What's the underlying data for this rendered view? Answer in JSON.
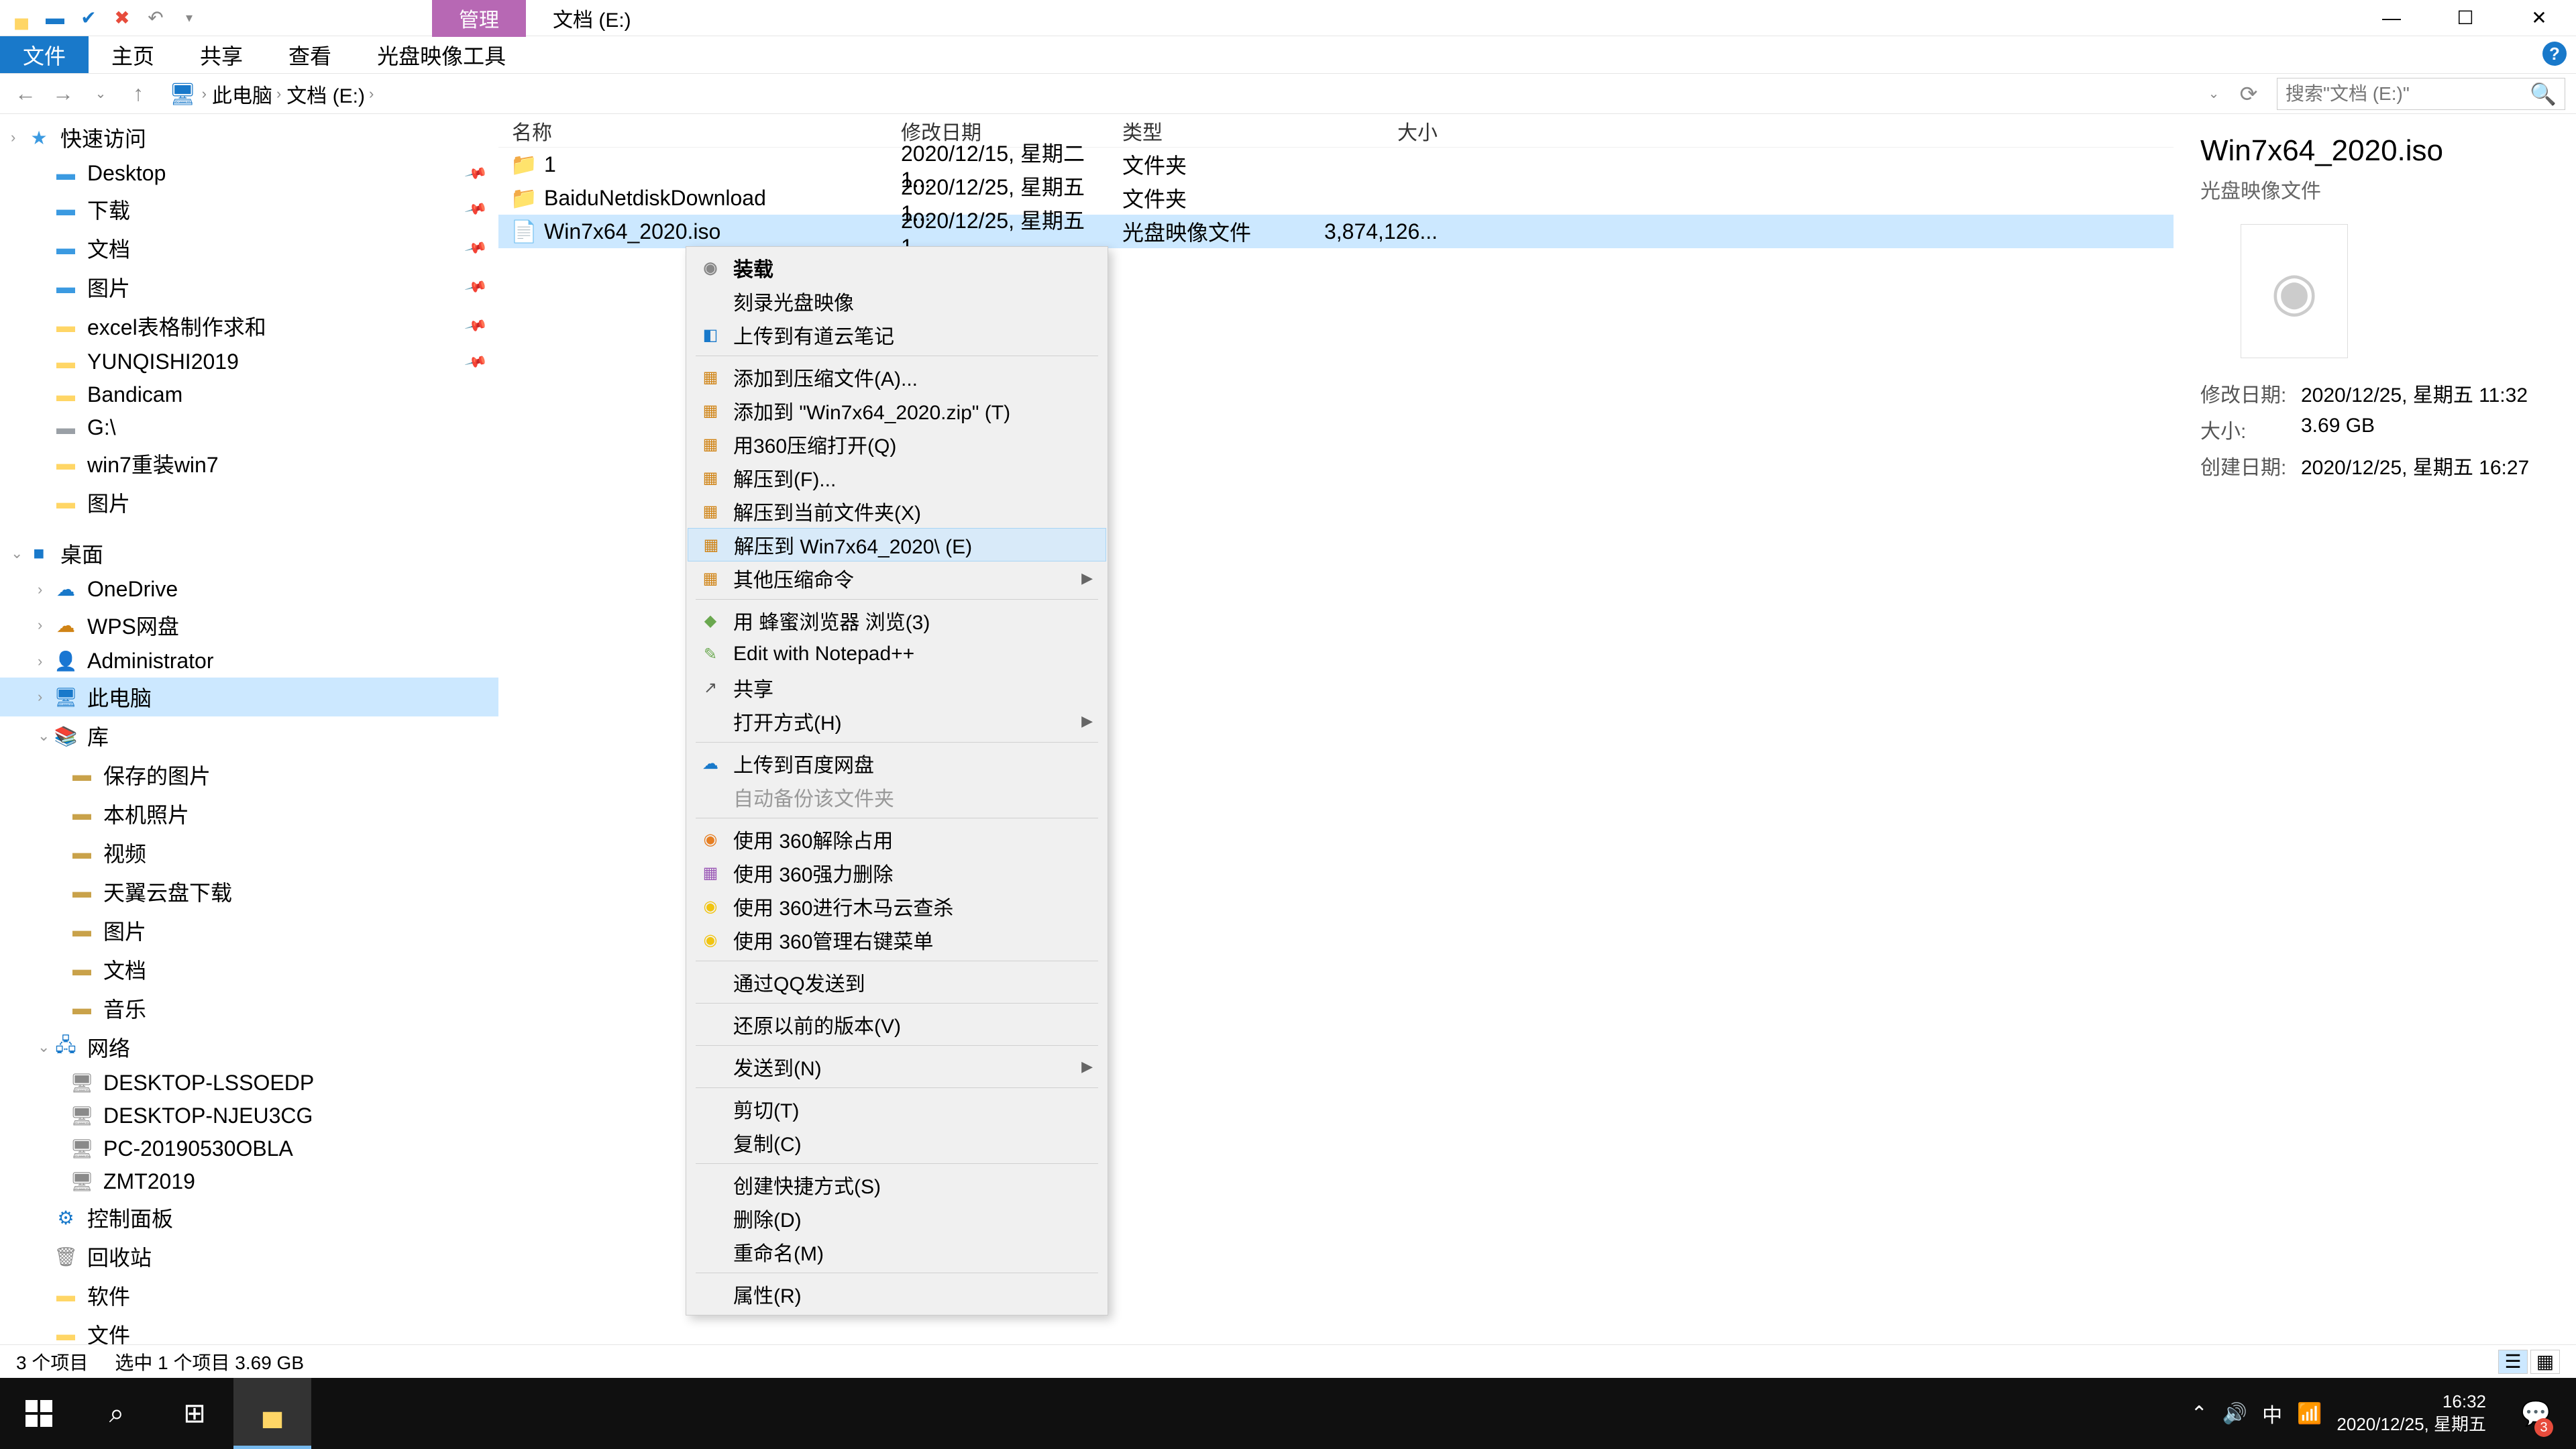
{
  "titlebar": {
    "contextual_tab": "管理",
    "location_title": "文档 (E:)"
  },
  "window_controls": {
    "min": "—",
    "max": "☐",
    "close": "✕"
  },
  "ribbon": {
    "tabs": [
      "文件",
      "主页",
      "共享",
      "查看",
      "光盘映像工具"
    ]
  },
  "addressbar": {
    "segments": [
      "此电脑",
      "文档 (E:)"
    ],
    "search_placeholder": "搜索\"文档 (E:)\""
  },
  "navpane": [
    {
      "label": "快速访问",
      "icon": "★",
      "color": "#3b9ae1",
      "chev": "›",
      "indent": 0
    },
    {
      "label": "Desktop",
      "icon": "▬",
      "color": "#3b9ae1",
      "indent": 1,
      "pin": true
    },
    {
      "label": "下载",
      "icon": "▬",
      "color": "#3b9ae1",
      "indent": 1,
      "pin": true
    },
    {
      "label": "文档",
      "icon": "▬",
      "color": "#3b9ae1",
      "indent": 1,
      "pin": true
    },
    {
      "label": "图片",
      "icon": "▬",
      "color": "#3b9ae1",
      "indent": 1,
      "pin": true
    },
    {
      "label": "excel表格制作求和",
      "icon": "▬",
      "color": "#ffd666",
      "indent": 1,
      "pin": true
    },
    {
      "label": "YUNQISHI2019",
      "icon": "▬",
      "color": "#ffd666",
      "indent": 1,
      "pin": true
    },
    {
      "label": "Bandicam",
      "icon": "▬",
      "color": "#ffd666",
      "indent": 1
    },
    {
      "label": "G:\\",
      "icon": "▬",
      "color": "#9aa0a6",
      "indent": 1
    },
    {
      "label": "win7重装win7",
      "icon": "▬",
      "color": "#ffd666",
      "indent": 1
    },
    {
      "label": "图片",
      "icon": "▬",
      "color": "#ffd666",
      "indent": 1
    },
    {
      "label": "桌面",
      "icon": "■",
      "color": "#1979ca",
      "chev": "⌄",
      "indent": 0,
      "top_space": true
    },
    {
      "label": "OneDrive",
      "icon": "☁",
      "color": "#1979ca",
      "indent": 1,
      "chev": "›"
    },
    {
      "label": "WPS网盘",
      "icon": "☁",
      "color": "#d08416",
      "indent": 1,
      "chev": "›"
    },
    {
      "label": "Administrator",
      "icon": "👤",
      "color": "#8a8a8a",
      "indent": 1,
      "chev": "›"
    },
    {
      "label": "此电脑",
      "icon": "🖥",
      "color": "#1979ca",
      "indent": 1,
      "selected": true,
      "chev": "›"
    },
    {
      "label": "库",
      "icon": "📚",
      "color": "#6aa84f",
      "indent": 1,
      "chev": "⌄"
    },
    {
      "label": "保存的图片",
      "icon": "▬",
      "color": "#c9a24a",
      "indent": 2
    },
    {
      "label": "本机照片",
      "icon": "▬",
      "color": "#c9a24a",
      "indent": 2
    },
    {
      "label": "视频",
      "icon": "▬",
      "color": "#c9a24a",
      "indent": 2
    },
    {
      "label": "天翼云盘下载",
      "icon": "▬",
      "color": "#c9a24a",
      "indent": 2
    },
    {
      "label": "图片",
      "icon": "▬",
      "color": "#c9a24a",
      "indent": 2
    },
    {
      "label": "文档",
      "icon": "▬",
      "color": "#c9a24a",
      "indent": 2
    },
    {
      "label": "音乐",
      "icon": "▬",
      "color": "#c9a24a",
      "indent": 2
    },
    {
      "label": "网络",
      "icon": "🖧",
      "color": "#1979ca",
      "indent": 1,
      "chev": "⌄"
    },
    {
      "label": "DESKTOP-LSSOEDP",
      "icon": "🖥",
      "color": "#8a8a8a",
      "indent": 2
    },
    {
      "label": "DESKTOP-NJEU3CG",
      "icon": "🖥",
      "color": "#8a8a8a",
      "indent": 2
    },
    {
      "label": "PC-20190530OBLA",
      "icon": "🖥",
      "color": "#8a8a8a",
      "indent": 2
    },
    {
      "label": "ZMT2019",
      "icon": "🖥",
      "color": "#8a8a8a",
      "indent": 2
    },
    {
      "label": "控制面板",
      "icon": "⚙",
      "color": "#1979ca",
      "indent": 1
    },
    {
      "label": "回收站",
      "icon": "🗑",
      "color": "#8a8a8a",
      "indent": 1
    },
    {
      "label": "软件",
      "icon": "▬",
      "color": "#ffd666",
      "indent": 1
    },
    {
      "label": "文件",
      "icon": "▬",
      "color": "#ffd666",
      "indent": 1
    }
  ],
  "columns": {
    "name": "名称",
    "date": "修改日期",
    "type": "类型",
    "size": "大小"
  },
  "files": [
    {
      "name": "1",
      "date": "2020/12/15, 星期二 1...",
      "type": "文件夹",
      "size": "",
      "icon": "folder"
    },
    {
      "name": "BaiduNetdiskDownload",
      "date": "2020/12/25, 星期五 1...",
      "type": "文件夹",
      "size": "",
      "icon": "folder"
    },
    {
      "name": "Win7x64_2020.iso",
      "date": "2020/12/25, 星期五 1...",
      "type": "光盘映像文件",
      "size": "3,874,126...",
      "icon": "iso",
      "selected": true
    }
  ],
  "context_menu": [
    {
      "label": "装载",
      "bold": true,
      "icon": "◉",
      "color": "#888"
    },
    {
      "label": "刻录光盘映像"
    },
    {
      "label": "上传到有道云笔记",
      "icon": "◧",
      "color": "#1979ca"
    },
    {
      "sep": true
    },
    {
      "label": "添加到压缩文件(A)...",
      "icon": "▦",
      "color": "#d08416"
    },
    {
      "label": "添加到 \"Win7x64_2020.zip\" (T)",
      "icon": "▦",
      "color": "#d08416"
    },
    {
      "label": "用360压缩打开(Q)",
      "icon": "▦",
      "color": "#d08416"
    },
    {
      "label": "解压到(F)...",
      "icon": "▦",
      "color": "#d08416"
    },
    {
      "label": "解压到当前文件夹(X)",
      "icon": "▦",
      "color": "#d08416"
    },
    {
      "label": "解压到 Win7x64_2020\\ (E)",
      "icon": "▦",
      "color": "#d08416",
      "hover": true
    },
    {
      "label": "其他压缩命令",
      "icon": "▦",
      "color": "#d08416",
      "submenu": true
    },
    {
      "sep": true
    },
    {
      "label": "用 蜂蜜浏览器 浏览(3)",
      "icon": "◆",
      "color": "#6aa84f"
    },
    {
      "label": "Edit with Notepad++",
      "icon": "✎",
      "color": "#6aa84f"
    },
    {
      "label": "共享",
      "icon": "↗",
      "color": "#555"
    },
    {
      "label": "打开方式(H)",
      "submenu": true
    },
    {
      "sep": true
    },
    {
      "label": "上传到百度网盘",
      "icon": "☁",
      "color": "#1979ca"
    },
    {
      "label": "自动备份该文件夹",
      "disabled": true
    },
    {
      "sep": true
    },
    {
      "label": "使用 360解除占用",
      "icon": "◉",
      "color": "#e67e22"
    },
    {
      "label": "使用 360强力删除",
      "icon": "▦",
      "color": "#9b59b6"
    },
    {
      "label": "使用 360进行木马云查杀",
      "icon": "◉",
      "color": "#f1c40f"
    },
    {
      "label": "使用 360管理右键菜单",
      "icon": "◉",
      "color": "#f1c40f"
    },
    {
      "sep": true
    },
    {
      "label": "通过QQ发送到"
    },
    {
      "sep": true
    },
    {
      "label": "还原以前的版本(V)"
    },
    {
      "sep": true
    },
    {
      "label": "发送到(N)",
      "submenu": true
    },
    {
      "sep": true
    },
    {
      "label": "剪切(T)"
    },
    {
      "label": "复制(C)"
    },
    {
      "sep": true
    },
    {
      "label": "创建快捷方式(S)"
    },
    {
      "label": "删除(D)"
    },
    {
      "label": "重命名(M)"
    },
    {
      "sep": true
    },
    {
      "label": "属性(R)"
    }
  ],
  "details": {
    "filename": "Win7x64_2020.iso",
    "filetype": "光盘映像文件",
    "props": [
      {
        "label": "修改日期:",
        "value": "2020/12/25, 星期五 11:32"
      },
      {
        "label": "大小:",
        "value": "3.69 GB"
      },
      {
        "label": "创建日期:",
        "value": "2020/12/25, 星期五 16:27"
      }
    ]
  },
  "statusbar": {
    "count": "3 个项目",
    "selected": "选中 1 个项目  3.69 GB"
  },
  "taskbar": {
    "time": "16:32",
    "date": "2020/12/25, 星期五",
    "ime": "中",
    "notif_count": "3"
  }
}
